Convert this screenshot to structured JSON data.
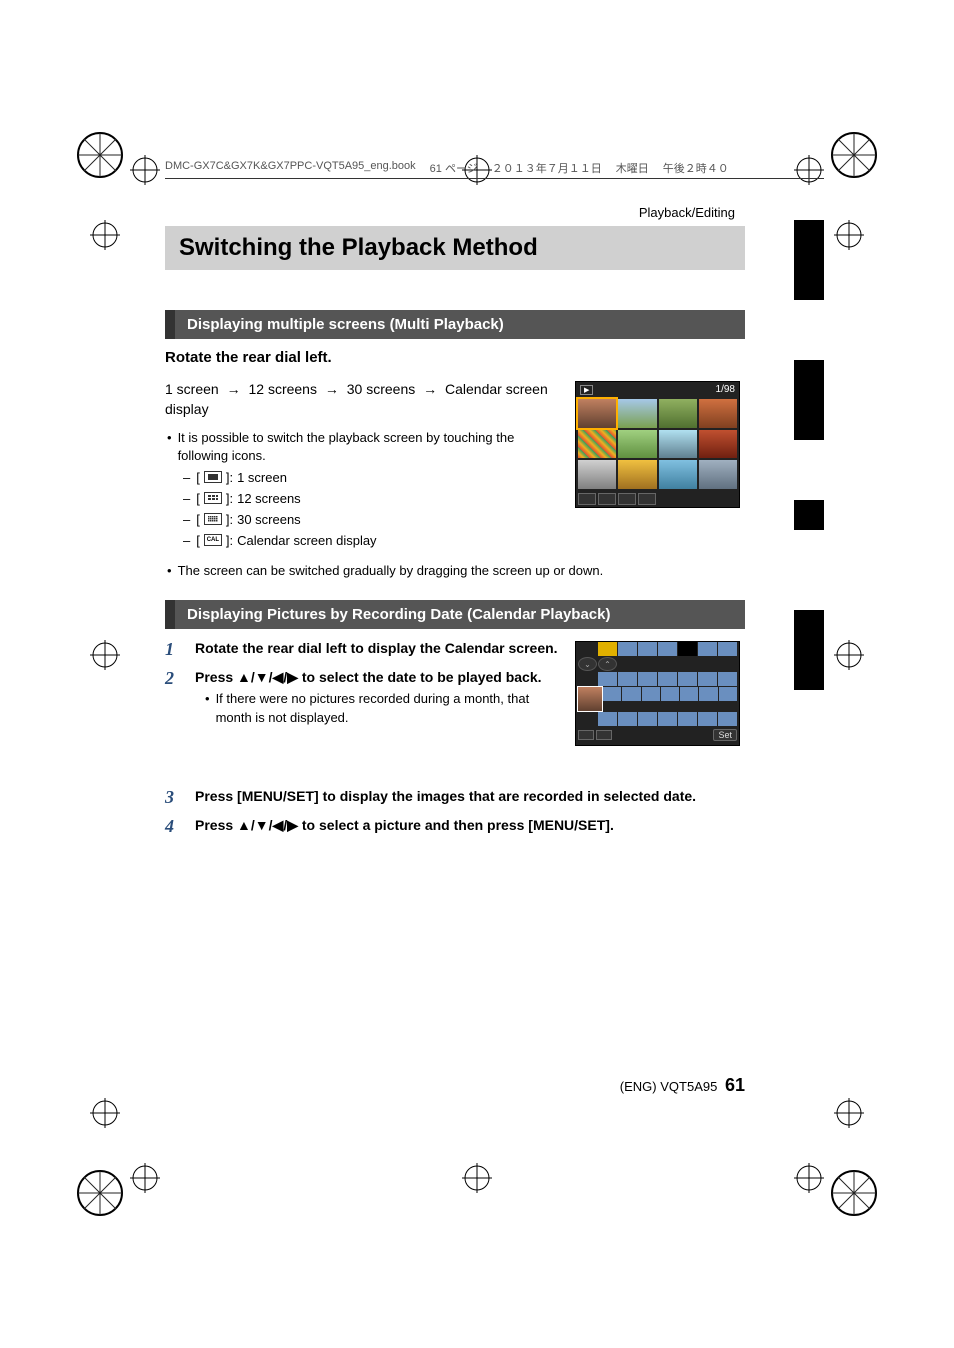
{
  "header": {
    "filename": "DMC-GX7C&GX7K&GX7PPC-VQT5A95_eng.book",
    "page_label": "61 ページ",
    "date": "２０１３年７月１１日",
    "weekday": "木曜日",
    "time": "午後２時４０"
  },
  "breadcrumb": "Playback/Editing",
  "title": "Switching the Playback Method",
  "section1": {
    "heading": "Displaying multiple screens (Multi Playback)",
    "instruction": "Rotate the rear dial left.",
    "flow": {
      "s1": "1 screen",
      "s2": "12 screens",
      "s3": "30 screens",
      "s4": "Calendar screen display"
    },
    "note1": "It is possible to switch the playback screen by touching the following icons.",
    "icons": {
      "i1": "1 screen",
      "i2": "12 screens",
      "i3": "30 screens",
      "i4": "Calendar screen display",
      "cal_label": "CAL"
    },
    "note2": "The screen can be switched gradually by dragging the screen up or down."
  },
  "section2": {
    "heading": "Displaying Pictures by Recording Date (Calendar Playback)",
    "steps": {
      "s1": "Rotate the rear dial left to display the Calendar screen.",
      "s2": "Press 3/4/2/1 to select the date to be played back.",
      "s2_sub": "If there were no pictures recorded during a month, that month is not displayed.",
      "s3": "Press [MENU/SET] to display the images that are recorded in selected date.",
      "s4": "Press 3/4/2/1 to select a picture and then press [MENU/SET]."
    }
  },
  "figure1": {
    "counter": "1/98"
  },
  "figure2": {
    "set_label": "Set"
  },
  "footer": {
    "lang": "(ENG)",
    "code": "VQT5A95",
    "page": "61"
  },
  "glyphs": {
    "arrow_right": "→",
    "up": "▲",
    "down": "▼",
    "left": "◀",
    "right": "▶",
    "play": "▶"
  }
}
